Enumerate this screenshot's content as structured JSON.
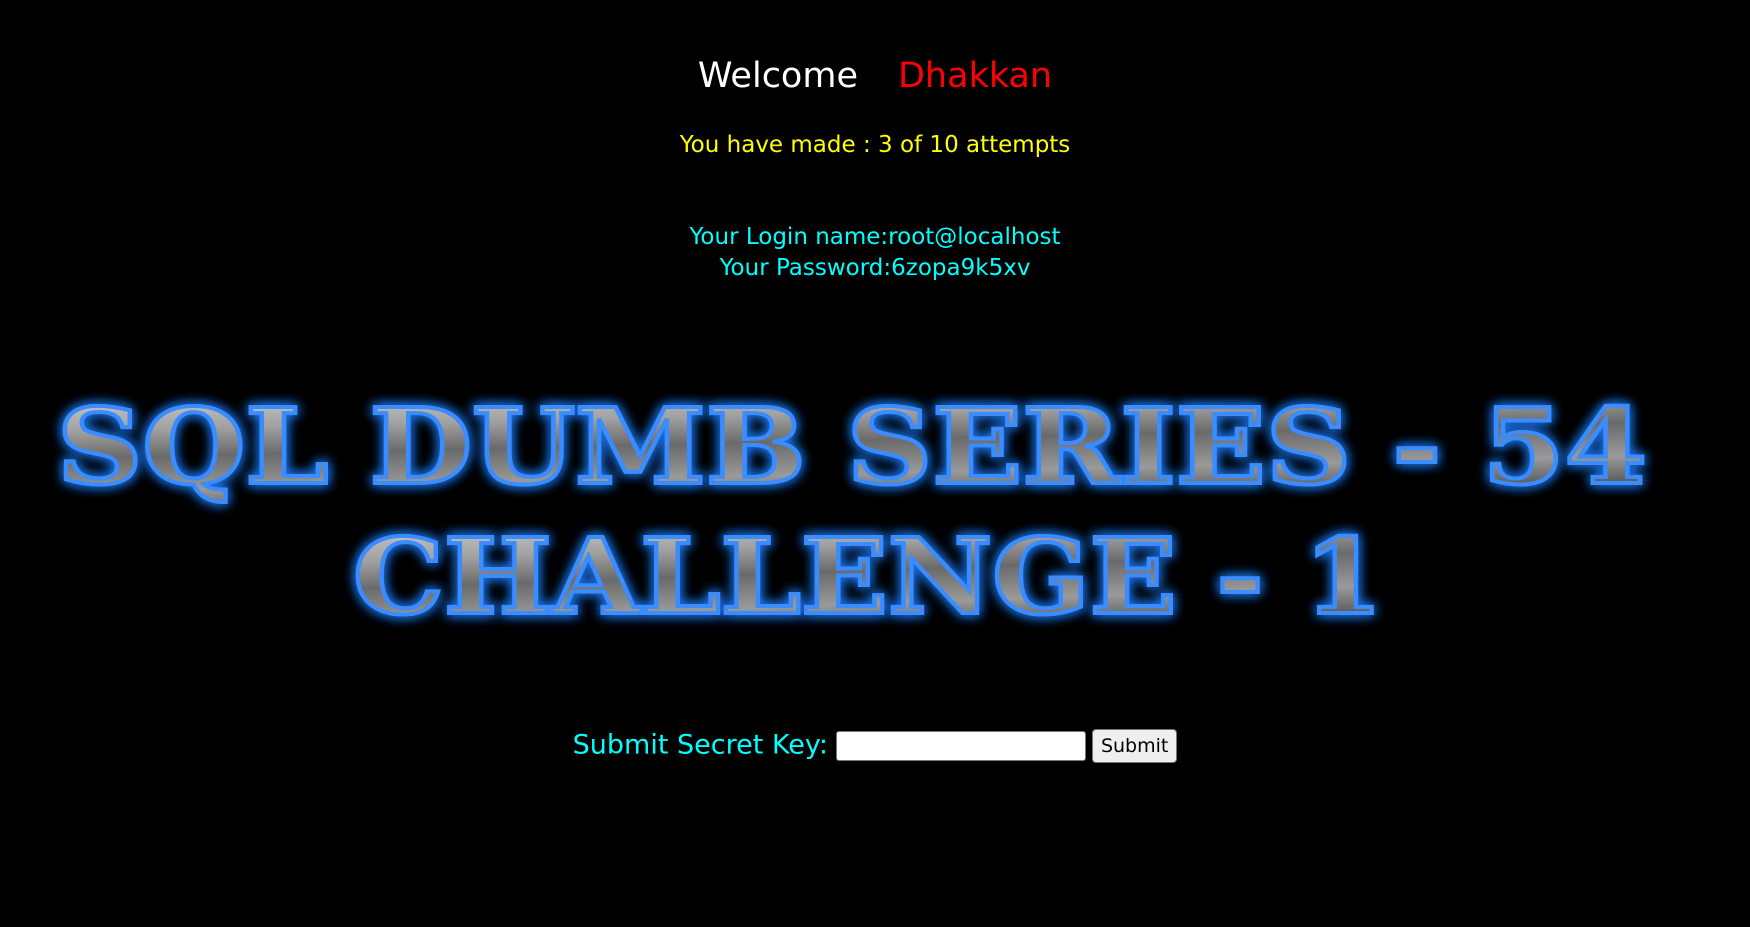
{
  "welcome": {
    "greeting": "Welcome",
    "username": "Dhakkan"
  },
  "attempts_text": "You have made : 3 of 10 attempts",
  "credentials": {
    "login_line": "Your Login name:root@localhost",
    "password_line": "Your Password:6zopa9k5xv"
  },
  "banner": {
    "line1": "SQL DUMB SERIES - 54",
    "line2": "CHALLENGE - 1"
  },
  "form": {
    "label": "Submit Secret Key:",
    "input_value": "",
    "button_label": "Submit"
  },
  "colors": {
    "background": "#000000",
    "welcome_word": "#ffffff",
    "username": "#ff0000",
    "attempts": "#ffff00",
    "credentials": "#00ffff",
    "banner_glow": "#1e6fe0",
    "banner_metal": "#8c8c8c"
  }
}
